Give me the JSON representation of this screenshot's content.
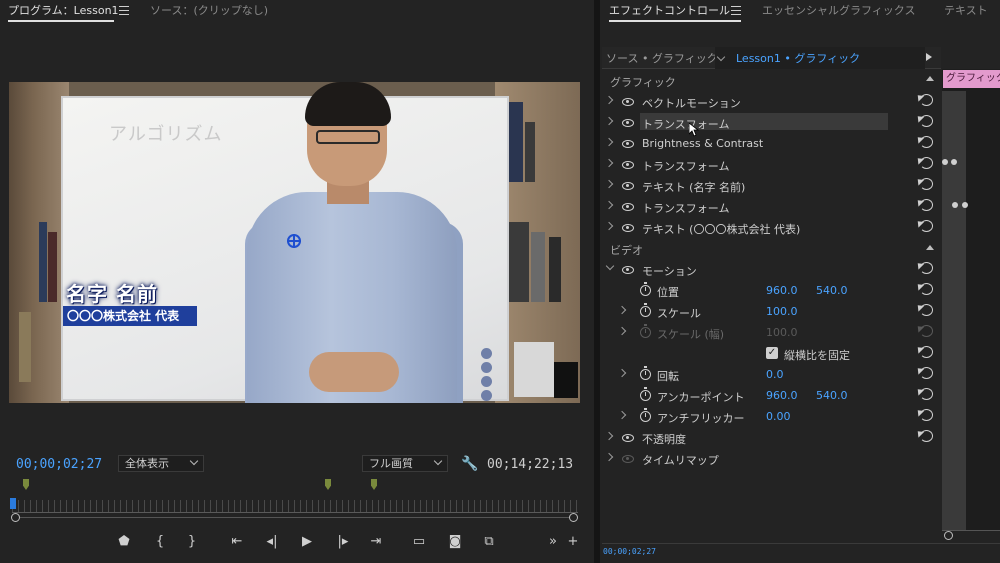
{
  "program_monitor": {
    "tab_program": "プログラム：Lesson1",
    "tab_source": "ソース：(クリップなし)",
    "timecode_current": "00;00;02;27",
    "timecode_duration": "00;14;22;13",
    "fit_dropdown": "全体表示",
    "quality_dropdown": "フル画質",
    "video": {
      "whiteboard_text": "アルゴリズム",
      "lower_third_name": "名字 名前",
      "lower_third_company": "〇〇〇株式会社 代表"
    },
    "transport_icons": [
      "marker-icon",
      "mark-in-icon",
      "mark-out-icon",
      "go-to-in-icon",
      "step-back-icon",
      "play-icon",
      "step-forward-icon",
      "go-to-out-icon",
      "safe-margins-icon",
      "export-frame-icon",
      "comparison-view-icon",
      "more-icon",
      "add-button-icon"
    ]
  },
  "effect_controls": {
    "tabs": [
      "エフェクトコントロール",
      "エッセンシャルグラフィックス",
      "テキスト"
    ],
    "source_label": "ソース • グラフィック",
    "clip_label": "Lesson1 • グラフィック",
    "timeline_clip_label": "グラフィック",
    "section_graphics": "グラフィック",
    "section_video": "ビデオ",
    "graphic_layers": [
      "ベクトルモーション",
      "トランスフォーム",
      "Brightness & Contrast",
      "トランスフォーム",
      "テキスト (名字 名前)",
      "トランスフォーム",
      "テキスト (〇〇〇株式会社 代表)"
    ],
    "motion": {
      "label": "モーション",
      "position_label": "位置",
      "position_x": "960.0",
      "position_y": "540.0",
      "scale_label": "スケール",
      "scale_value": "100.0",
      "scale_width_label": "スケール (幅)",
      "scale_width_value": "100.0",
      "uniform_scale_label": "縦横比を固定",
      "rotation_label": "回転",
      "rotation_value": "0.0",
      "anchor_label": "アンカーポイント",
      "anchor_x": "960.0",
      "anchor_y": "540.0",
      "antiflicker_label": "アンチフリッカー",
      "antiflicker_value": "0.00"
    },
    "opacity_label": "不透明度",
    "time_remap_label": "タイムリマップ",
    "bottom_timecode": "00;00;02;27"
  },
  "colors": {
    "accent_blue": "#4aa3ff",
    "lower_third_bar": "#1f3f9c",
    "clip_pink": "#e39acd"
  }
}
